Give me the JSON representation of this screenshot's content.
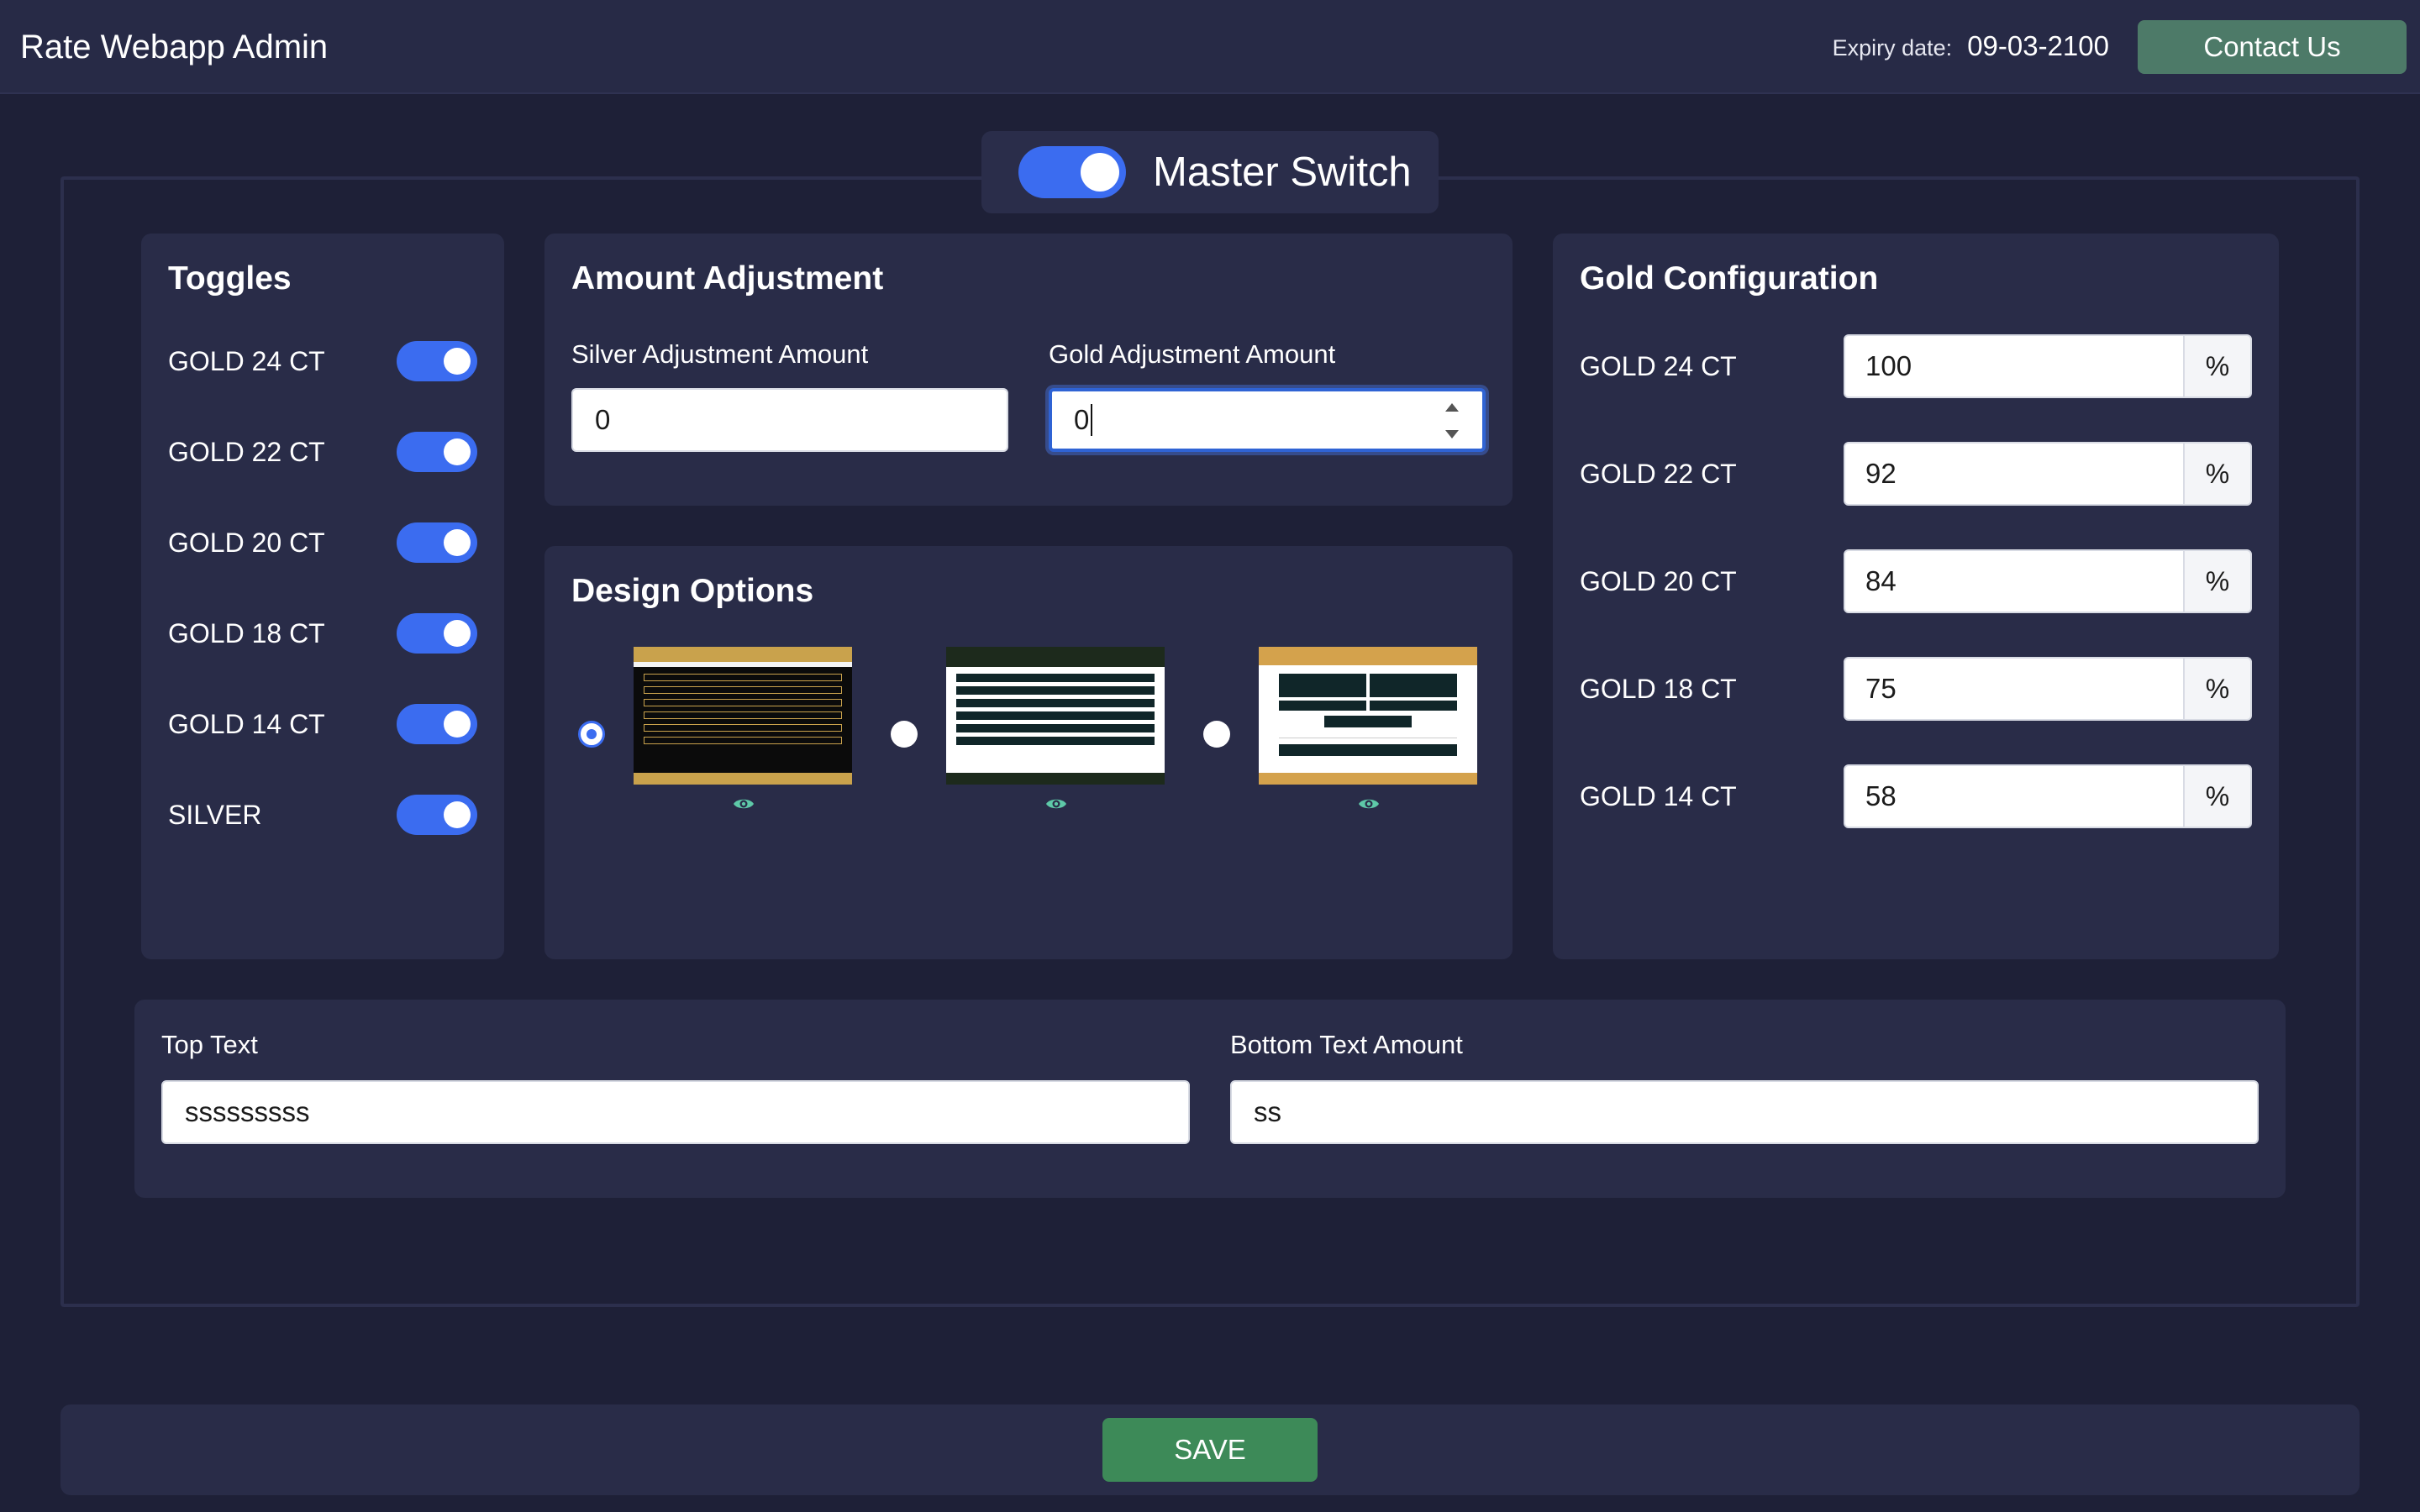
{
  "header": {
    "app_title": "Rate Webapp Admin",
    "expiry_label": "Expiry date:",
    "expiry_value": "09-03-2100",
    "contact_label": "Contact Us"
  },
  "master_switch": {
    "label": "Master Switch",
    "on": true
  },
  "toggles": {
    "title": "Toggles",
    "items": [
      {
        "label": "GOLD 24 CT",
        "on": true
      },
      {
        "label": "GOLD 22 CT",
        "on": true
      },
      {
        "label": "GOLD 20 CT",
        "on": true
      },
      {
        "label": "GOLD 18 CT",
        "on": true
      },
      {
        "label": "GOLD 14 CT",
        "on": true
      },
      {
        "label": "SILVER",
        "on": true
      }
    ]
  },
  "amount_adjustment": {
    "title": "Amount Adjustment",
    "silver_label": "Silver Adjustment Amount",
    "silver_value": "0",
    "gold_label": "Gold Adjustment Amount",
    "gold_value": "0"
  },
  "design_options": {
    "title": "Design Options",
    "options": [
      {
        "name": "dark-gold-theme",
        "selected": true
      },
      {
        "name": "dark-green-theme",
        "selected": false
      },
      {
        "name": "gold-white-theme",
        "selected": false
      }
    ],
    "preview_icon": "eye-icon"
  },
  "gold_configuration": {
    "title": "Gold Configuration",
    "suffix": "%",
    "items": [
      {
        "label": "GOLD 24 CT",
        "value": "100"
      },
      {
        "label": "GOLD 22 CT",
        "value": "92"
      },
      {
        "label": "GOLD 20 CT",
        "value": "84"
      },
      {
        "label": "GOLD 18 CT",
        "value": "75"
      },
      {
        "label": "GOLD 14 CT",
        "value": "58"
      }
    ]
  },
  "texts": {
    "top_label": "Top Text",
    "top_value": "sssssssss",
    "bottom_label": "Bottom Text Amount",
    "bottom_value": "ss"
  },
  "save": {
    "label": "SAVE"
  },
  "colors": {
    "background": "#1e2037",
    "panel": "#292c48",
    "accent_blue": "#3b6cf0",
    "contact_green": "#4d7a68",
    "save_green": "#3d8a58",
    "eye_teal": "#5ec9a8"
  }
}
